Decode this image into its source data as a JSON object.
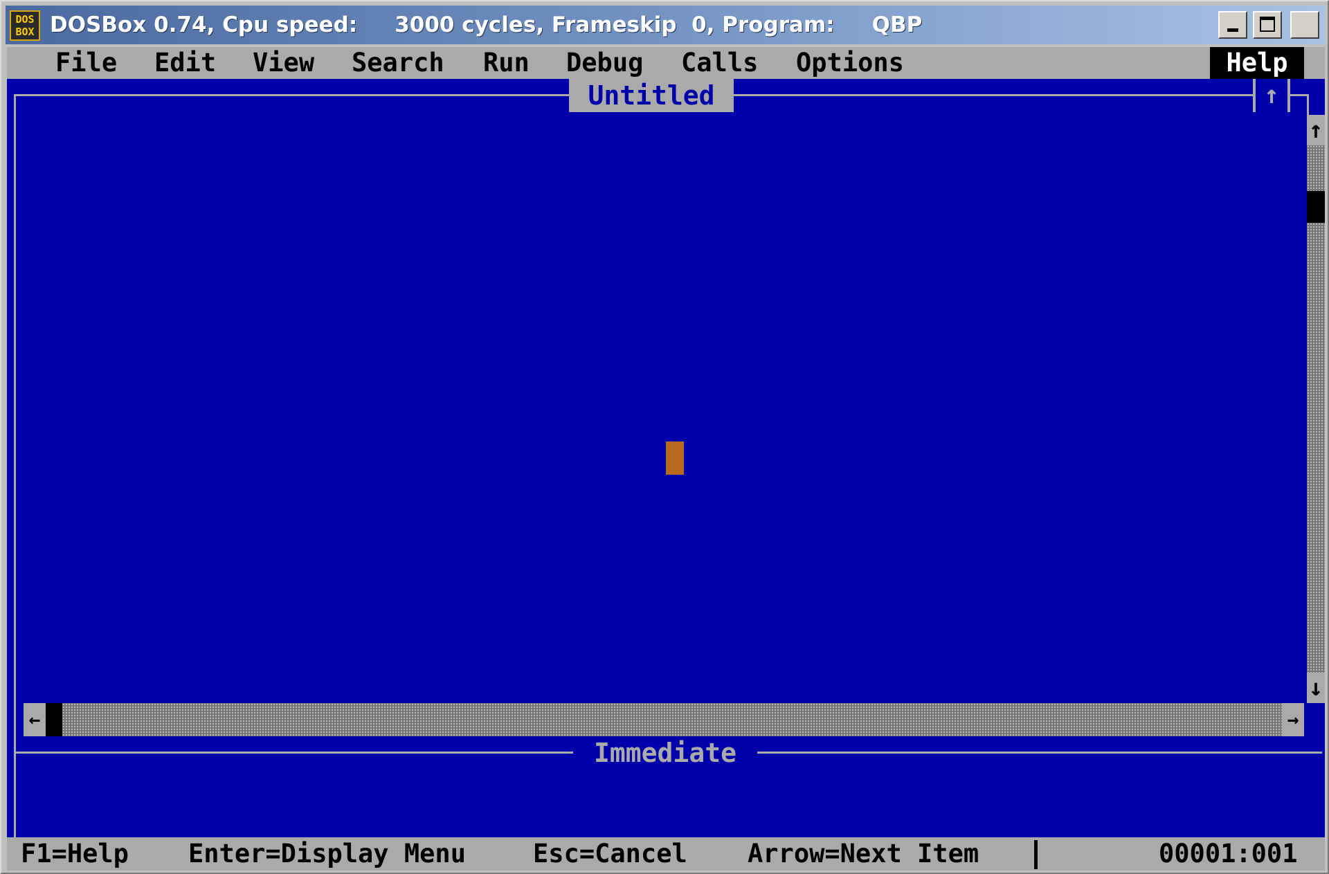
{
  "titlebar": {
    "icon_text": "DOS\nBOX",
    "title": "DOSBox 0.74, Cpu speed:     3000 cycles, Frameskip  0, Program:     QBP"
  },
  "menu": {
    "items": [
      "File",
      "Edit",
      "View",
      "Search",
      "Run",
      "Debug",
      "Calls",
      "Options"
    ],
    "help": "Help"
  },
  "editor": {
    "title": "Untitled",
    "maximize_glyph": "↑",
    "scroll_up_glyph": "↑",
    "scroll_down_glyph": "↓",
    "scroll_left_glyph": "←",
    "scroll_right_glyph": "→"
  },
  "immediate": {
    "title": "Immediate"
  },
  "statusbar": {
    "f1": "F1=Help",
    "enter": "Enter=Display Menu",
    "esc": "Esc=Cancel",
    "arrow": "Arrow=Next Item",
    "position": "00001:001"
  },
  "colors": {
    "dos_blue": "#0000aa",
    "dos_gray": "#aaaaaa",
    "cursor": "#b86a20"
  }
}
